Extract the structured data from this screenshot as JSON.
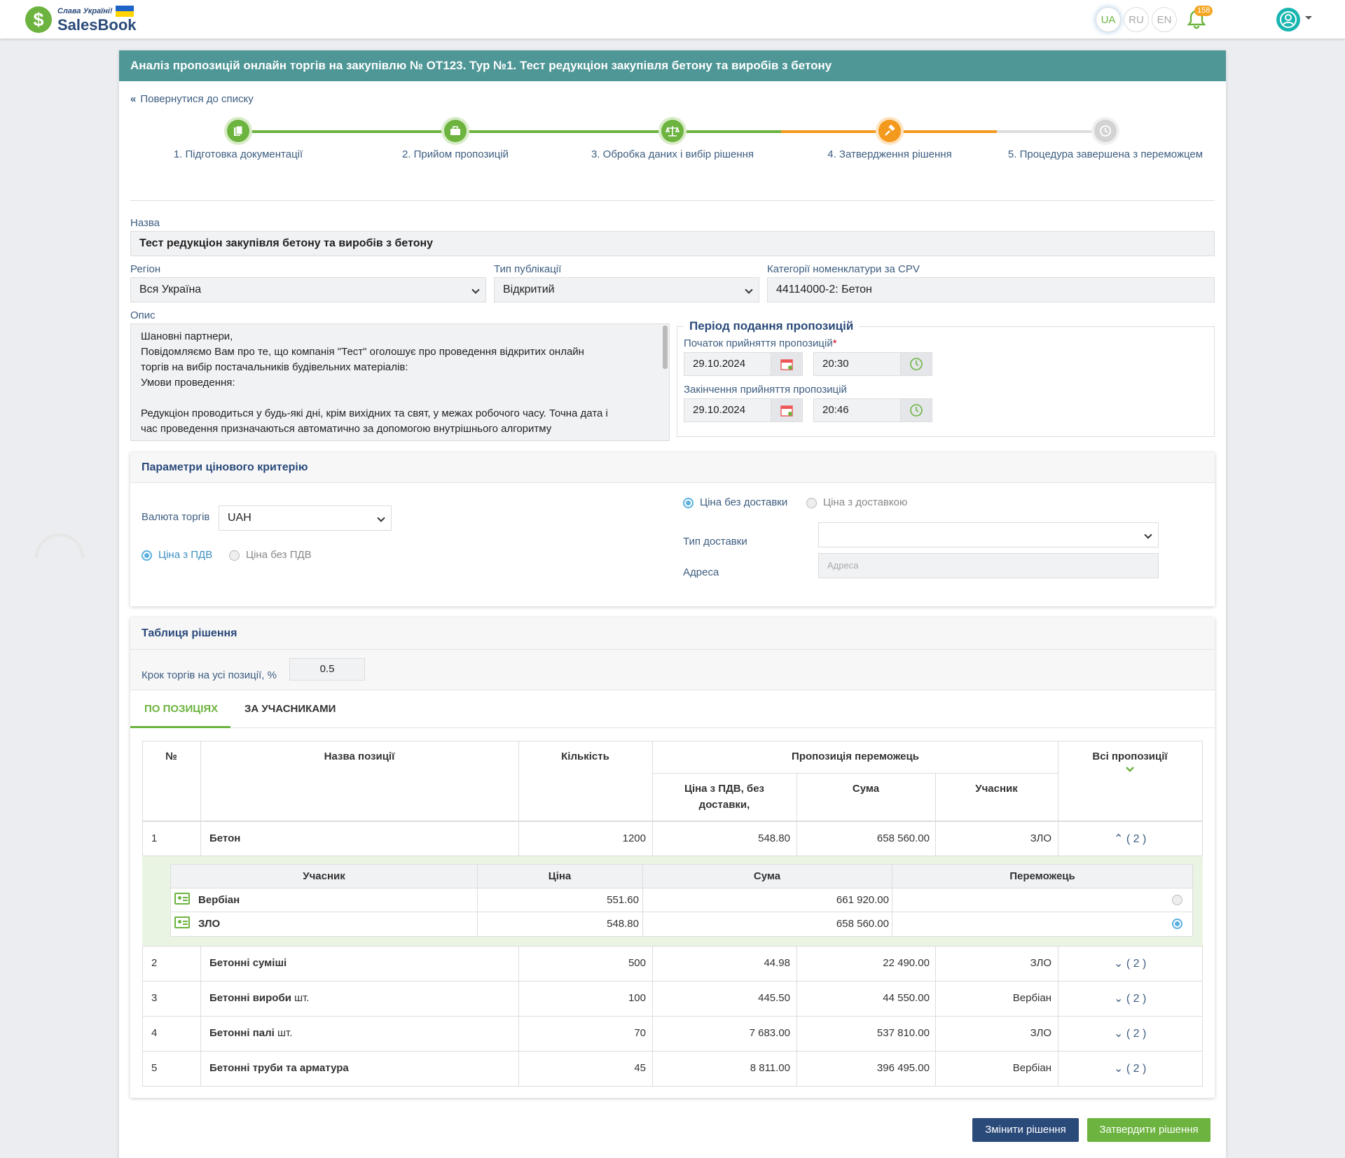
{
  "header": {
    "slogan": "Слава Україні!",
    "brand": "SalesBook",
    "langs": [
      "UA",
      "RU",
      "EN"
    ],
    "notif_count": "158",
    "logo_symbol": "$"
  },
  "page": {
    "title": "Аналіз пропозицій онлайн торгів на закупівлю № ОТ123. Тур №1. Тест редукціон закупівля бетону та виробів з бетону",
    "back": "Повернутися до списку"
  },
  "steps": [
    "1. Підготовка документації",
    "2. Прийом пропозицій",
    "3. Обробка даних і вибір рішення",
    "4. Затвердження рішення",
    "5. Процедура завершена з переможцем"
  ],
  "colors": {
    "done": "#6cb33f",
    "active": "#f39a1e",
    "pending": "#cccccc",
    "header": "#4f9696",
    "navy": "#2a4a7a"
  },
  "form": {
    "name_label": "Назва",
    "name_value": "Тест редукціон закупівля бетону та виробів з бетону",
    "region_label": "Регіон",
    "region_value": "Вся Україна",
    "pub_label": "Тип публікації",
    "pub_value": "Відкритий",
    "cpv_label": "Категорії номенклатури за CPV",
    "cpv_value": "44114000-2: Бетон",
    "desc_label": "Опис",
    "desc_lines": [
      "Шановні партнери,",
      "Повідомляємо Вам про те, що компанія \"Тест\" оголошує про проведення відкритих онлайн",
      "торгів  на вибір постачальників будівельних матеріалів:",
      "Умови проведення:",
      "",
      "Редукціон проводиться у будь-які дні, крім вихідних та свят, у межах робочого часу. Точна дата і",
      "час проведення призначаються автоматично за допомогою внутрішнього алгоритму"
    ]
  },
  "period": {
    "title": "Період подання пропозицій",
    "start_label": "Початок прийняття пропозицій",
    "start_date": "29.10.2024",
    "start_time": "20:30",
    "end_label": "Закінчення прийняття пропозицій",
    "end_date": "29.10.2024",
    "end_time": "20:46"
  },
  "price": {
    "title": "Параметри цінового критерію",
    "currency_label": "Валюта торгів",
    "currency_value": "UAH",
    "vat_on": "Ціна з ПДВ",
    "vat_off": "Ціна без ПДВ",
    "no_delivery": "Ціна без доставки",
    "with_delivery": "Ціна з доставкою",
    "delivery_type_label": "Тип доставки",
    "delivery_type_value": "",
    "address_label": "Адреса",
    "address_placeholder": "Адреса"
  },
  "decision": {
    "title": "Таблиця рішення",
    "step_label": "Крок торгів на усі позиції, %",
    "step_value": "0.5",
    "tabs": [
      "ПО ПОЗИЦІЯХ",
      "ЗА УЧАСНИКАМИ"
    ]
  },
  "table": {
    "headers": {
      "no": "№",
      "name": "Назва позиції",
      "qty": "Кількість",
      "winner_offer": "Пропозиція переможець",
      "price": "Ціна  з ПДВ,  без",
      "price2": "доставки,",
      "sum": "Сума",
      "participant": "Учасник",
      "all": "Всі пропозиції"
    },
    "rows": [
      {
        "no": "1",
        "name": "Бетон",
        "unit": "",
        "qty": "1200",
        "price": "548.80",
        "sum": "658 560.00",
        "participant": "ЗЛО",
        "count": "( 2 )"
      },
      {
        "no": "2",
        "name": "Бетонні суміші",
        "unit": "",
        "qty": "500",
        "price": "44.98",
        "sum": "22 490.00",
        "participant": "ЗЛО",
        "count": "( 2 )"
      },
      {
        "no": "3",
        "name": "Бетонні вироби",
        "unit": "шт.",
        "qty": "100",
        "price": "445.50",
        "sum": "44 550.00",
        "participant": "Вербіан",
        "count": "( 2 )"
      },
      {
        "no": "4",
        "name": "Бетонні палі",
        "unit": "шт.",
        "qty": "70",
        "price": "7 683.00",
        "sum": "537 810.00",
        "participant": "ЗЛО",
        "count": "( 2 )"
      },
      {
        "no": "5",
        "name": "Бетонні труби та арматура",
        "unit": "",
        "qty": "45",
        "price": "8 811.00",
        "sum": "396 495.00",
        "participant": "Вербіан",
        "count": "( 2 )"
      }
    ],
    "sub_headers": {
      "participant": "Учасник",
      "price": "Ціна",
      "sum": "Сума",
      "winner": "Переможець"
    },
    "sub_rows": [
      {
        "participant": "Вербіан",
        "price": "551.60",
        "sum": "661 920.00",
        "winner": false
      },
      {
        "participant": "ЗЛО",
        "price": "548.80",
        "sum": "658 560.00",
        "winner": true
      }
    ]
  },
  "buttons": {
    "change": "Змінити рішення",
    "approve": "Затвердити рішення"
  }
}
